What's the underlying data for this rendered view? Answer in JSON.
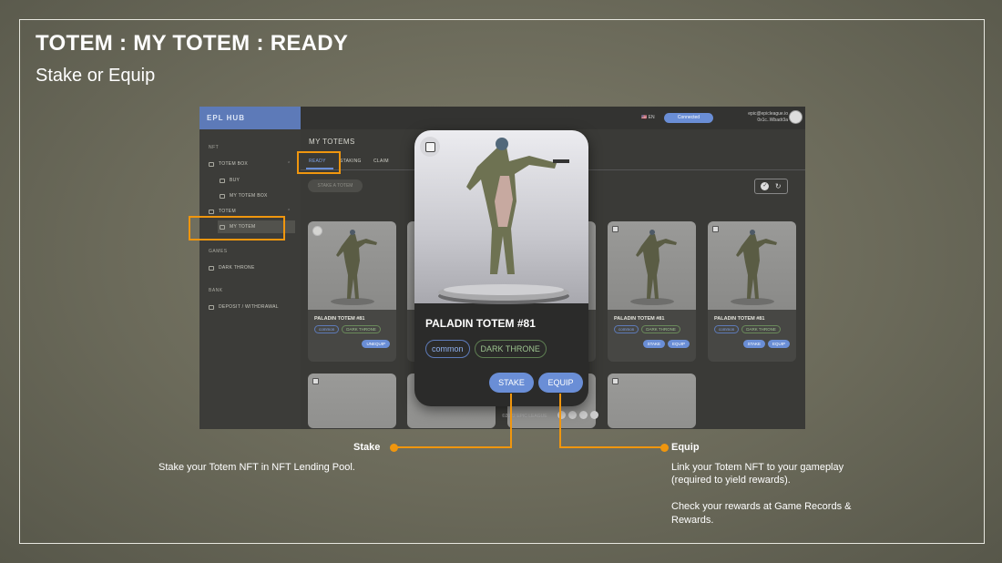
{
  "slide": {
    "title": "TOTEM : MY TOTEM : READY",
    "subtitle": "Stake or Equip"
  },
  "app": {
    "logo": "EPL HUB",
    "sidebar": {
      "sections": [
        {
          "label": "NFT"
        },
        {
          "label": "GAMES"
        },
        {
          "label": "BANK"
        }
      ],
      "items": [
        {
          "label": "TOTEM BOX"
        },
        {
          "label": "BUY"
        },
        {
          "label": "MY TOTEM BOX"
        },
        {
          "label": "TOTEM"
        },
        {
          "label": "MY TOTEM"
        },
        {
          "label": "DARK THRONE"
        },
        {
          "label": "DEPOSIT / WITHDRAWAL"
        }
      ]
    },
    "topbar": {
      "language": "EN",
      "connected": "Connected",
      "user_email": "epic@epicleague.io",
      "user_address": "0x1c..Wbadr3a"
    },
    "page_title": "MY TOTEMS",
    "tabs": [
      {
        "label": "READY"
      },
      {
        "label": "STAKING"
      },
      {
        "label": "CLAIM"
      }
    ],
    "stake_a_totem": "STAKE A TOTEM",
    "cards": [
      {
        "name": "PALADIN TOTEM #81",
        "tag1": "common",
        "tag2": "DARK THRONE",
        "btn1": "UNEQUIP"
      },
      {
        "name": "PALADIN TOTEM #81",
        "tag1": "common",
        "tag2": "DARK THRONE",
        "btn1": "STAKE",
        "btn2": "EQUIP"
      },
      {
        "name": "PALADIN TOTEM #81",
        "tag1": "common",
        "tag2": "DARK THRONE",
        "btn1": "STAKE",
        "btn2": "EQUIP"
      }
    ],
    "footer": "©2022 EPIC LEAGUE"
  },
  "popup": {
    "name": "PALADIN TOTEM #81",
    "tag1": "common",
    "tag2": "DARK THRONE",
    "stake": "STAKE",
    "equip": "EQUIP"
  },
  "annotations": {
    "stake_label": "Stake",
    "stake_text": "Stake your Totem NFT in NFT Lending Pool.",
    "equip_label": "Equip",
    "equip_text_1": "Link your Totem NFT to your gameplay",
    "equip_text_2": "(required to yield rewards).",
    "equip_text_3": "Check your rewards at Game Records &",
    "equip_text_4": "Rewards."
  },
  "colors": {
    "accent": "#6a8ed6",
    "highlight": "#f0960e"
  }
}
